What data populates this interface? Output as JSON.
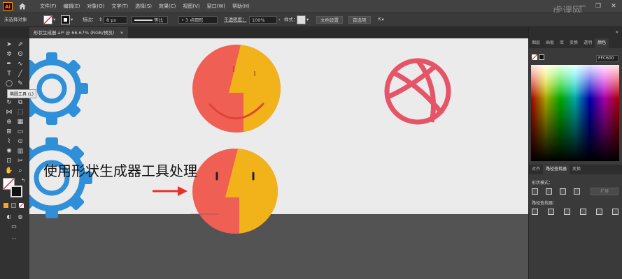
{
  "app": {
    "logo": "Ai"
  },
  "menu": [
    "文件(F)",
    "编辑(E)",
    "对象(O)",
    "文字(T)",
    "选择(S)",
    "效果(C)",
    "视图(V)",
    "窗口(W)",
    "帮助(H)"
  ],
  "control_bar": {
    "no_selection": "未选择对象",
    "stroke_label": "描边：",
    "stroke_value": "8 px",
    "profile_label": "等比",
    "brush_label": "3 点圆形",
    "opacity_label": "不透明度：",
    "opacity_value": "100%",
    "style_label": "样式：",
    "doc_setup": "文档设置",
    "preferences": "首选项"
  },
  "document": {
    "tab_title": "形状生成器.ai* @ 66.67% (RGB/预览)",
    "close": "×"
  },
  "tooltip": "椭圆工具 (L)",
  "subtitle": "使用形状生成器工具处理",
  "panel": {
    "tabs": [
      "图层",
      "画板",
      "库",
      "变换",
      "透明",
      "颜色"
    ],
    "hex_value": "FFC600",
    "lower_tabs": [
      "对齐",
      "路径查找器",
      "变换"
    ],
    "shape_modes_label": "形状模式：",
    "pathfinder_label": "路径查找器：",
    "expand_label": "扩展"
  },
  "watermark": "虎课网",
  "colors": {
    "gear_blue": "#2f8fd8",
    "face_red": "#f05f53",
    "face_yellow": "#f2b21a",
    "ball_pink": "#e65468",
    "arrow_red": "#e8302a"
  }
}
